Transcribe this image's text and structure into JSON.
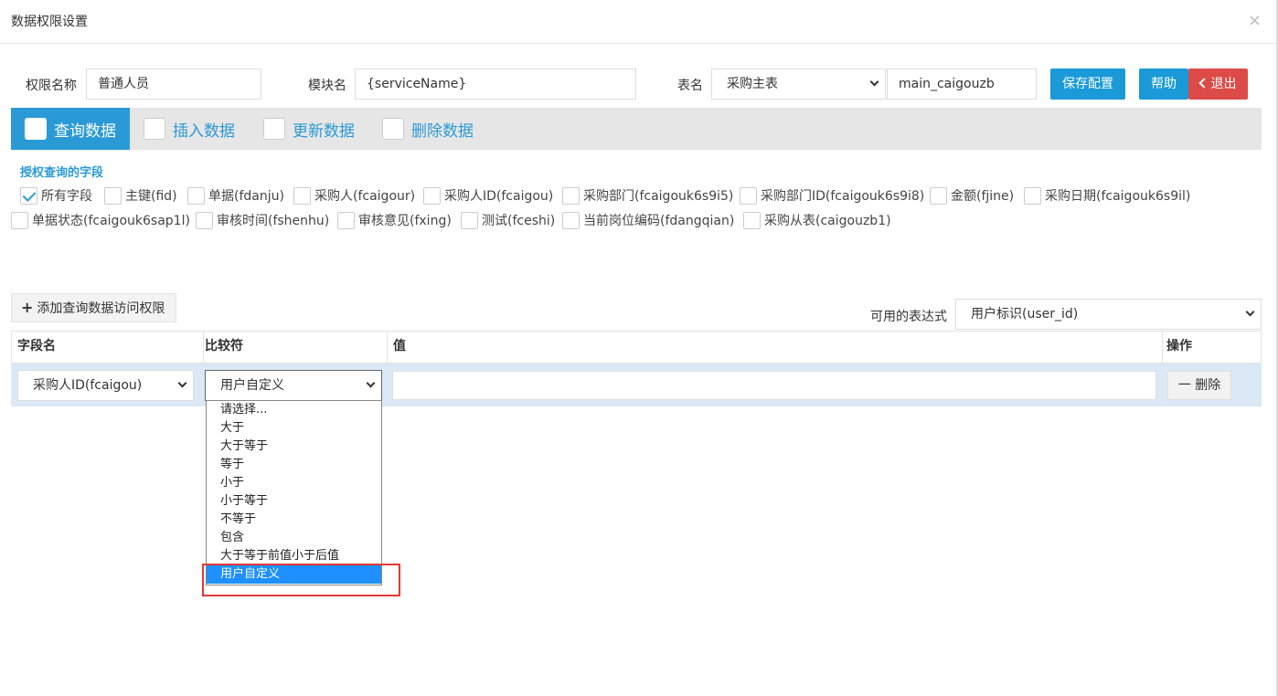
{
  "dialog": {
    "title": "数据权限设置",
    "close_icon": "×"
  },
  "form": {
    "perm_name_label": "权限名称",
    "perm_name_value": "普通人员",
    "module_label": "模块名",
    "module_value": "{serviceName}",
    "table_label": "表名",
    "table_select": "采购主表",
    "table_code": "main_caigouzb",
    "save_label": "保存配置",
    "help_label": "帮助",
    "exit_label": "退出"
  },
  "tabs": [
    {
      "label": "查询数据"
    },
    {
      "label": "插入数据"
    },
    {
      "label": "更新数据"
    },
    {
      "label": "删除数据"
    }
  ],
  "section_title": "授权查询的字段",
  "fields": [
    {
      "label": "所有字段",
      "checked": true
    },
    {
      "label": "主键(fid)",
      "checked": false
    },
    {
      "label": "单据(fdanju)",
      "checked": false
    },
    {
      "label": "采购人(fcaigour)",
      "checked": false
    },
    {
      "label": "采购人ID(fcaigou)",
      "checked": false
    },
    {
      "label": "采购部门(fcaigouk6s9i5)",
      "checked": false
    },
    {
      "label": "采购部门ID(fcaigouk6s9i8)",
      "checked": false
    },
    {
      "label": "金额(fjine)",
      "checked": false
    },
    {
      "label": "采购日期(fcaigouk6s9il)",
      "checked": false
    },
    {
      "label": "单据状态(fcaigouk6sap1l)",
      "checked": false
    },
    {
      "label": "审核时间(fshenhu)",
      "checked": false
    },
    {
      "label": "审核意见(fxing)",
      "checked": false
    },
    {
      "label": "测试(fceshi)",
      "checked": false
    },
    {
      "label": "当前岗位编码(fdangqian)",
      "checked": false
    },
    {
      "label": "采购从表(caigouzb1)",
      "checked": false
    }
  ],
  "add_button": {
    "plus": "+",
    "label": "添加查询数据访问权限"
  },
  "expression": {
    "label": "可用的表达式",
    "value": "用户标识(user_id)"
  },
  "table": {
    "headers": [
      "字段名",
      "比较符",
      "值",
      "操作"
    ],
    "row": {
      "field": "采购人ID(fcaigou)",
      "comparator": "用户自定义",
      "value": "",
      "delete_label": "一 删除"
    }
  },
  "dropdown": {
    "options": [
      "请选择...",
      "大于",
      "大于等于",
      "等于",
      "小于",
      "小于等于",
      "不等于",
      "包含",
      "大于等于前值小于后值",
      "用户自定义"
    ],
    "selected_index": 9
  }
}
